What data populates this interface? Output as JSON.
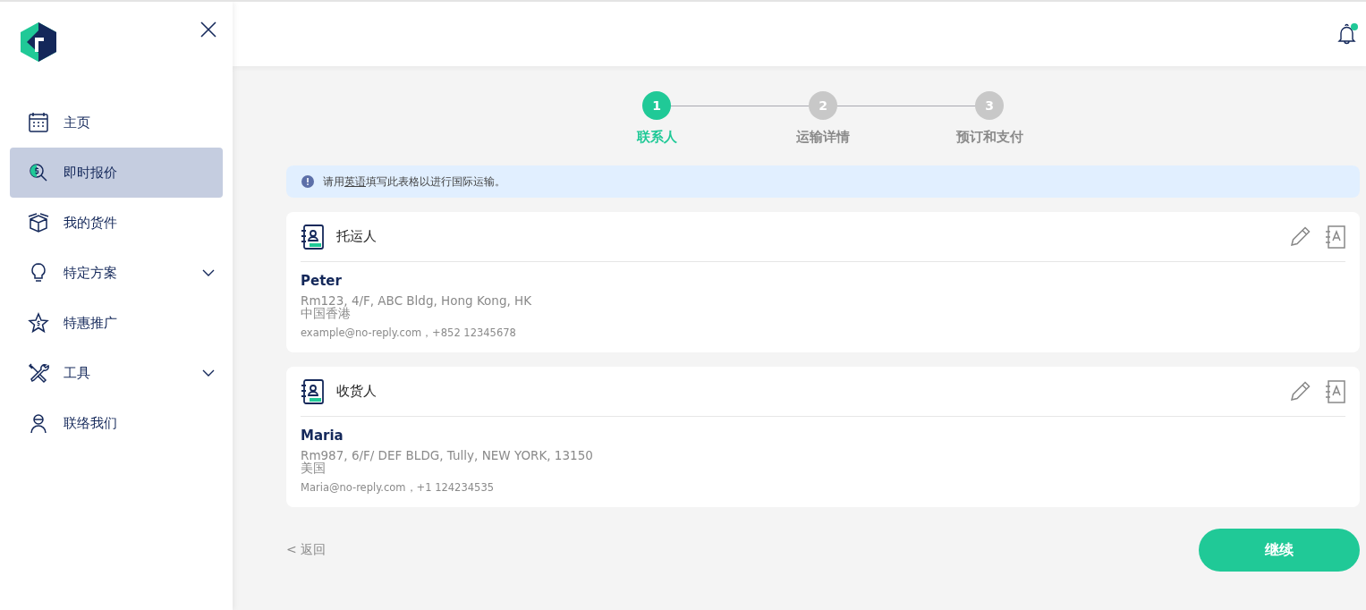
{
  "sidebar": {
    "items": [
      {
        "label": "主页",
        "selected": false,
        "expandable": false
      },
      {
        "label": "即时报价",
        "selected": true,
        "expandable": false
      },
      {
        "label": "我的货件",
        "selected": false,
        "expandable": false
      },
      {
        "label": "特定方案",
        "selected": false,
        "expandable": true
      },
      {
        "label": "特惠推广",
        "selected": false,
        "expandable": false
      },
      {
        "label": "工具",
        "selected": false,
        "expandable": true
      },
      {
        "label": "联络我们",
        "selected": false,
        "expandable": false
      }
    ]
  },
  "header": {
    "notification_unread": true
  },
  "steps": [
    {
      "number": "1",
      "label": "联系人",
      "selected": true
    },
    {
      "number": "2",
      "label": "运输详情",
      "selected": false
    },
    {
      "number": "3",
      "label": "预订和支付",
      "selected": false
    }
  ],
  "notice": {
    "before": "请用",
    "link": "英语",
    "after": "填写此表格以进行国际运输。"
  },
  "contacts": [
    {
      "title": "托运人",
      "name": "Peter",
      "address": "Rm123, 4/F, ABC Bldg, Hong Kong, HK",
      "country": "中国香港",
      "contact": "example@no-reply.com，+852 12345678"
    },
    {
      "title": "收货人",
      "name": "Maria",
      "address": "Rm987, 6/F/ DEF BLDG, Tully, NEW YORK, 13150",
      "country": "美国",
      "contact": "Maria@no-reply.com，+1 124234535"
    }
  ],
  "back": "< 返回",
  "continue": "继续"
}
